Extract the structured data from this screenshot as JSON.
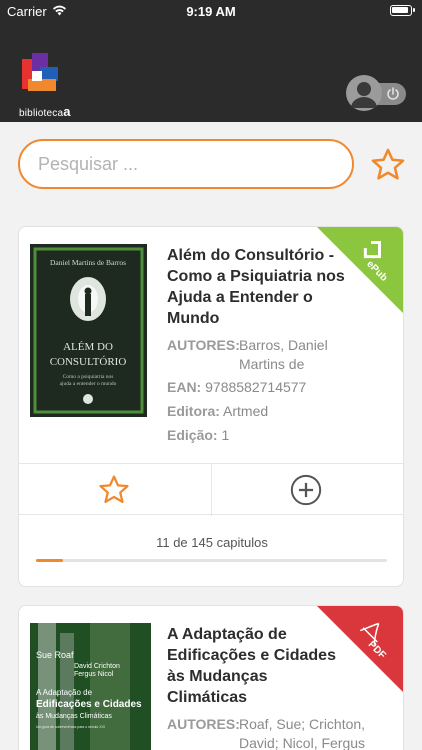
{
  "status_bar": {
    "carrier": "Carrier",
    "time": "9:19 AM"
  },
  "header": {
    "logo_text": "biblioteca",
    "logo_suffix": "a"
  },
  "search": {
    "placeholder": "Pesquisar ..."
  },
  "colors": {
    "accent": "#f0882d",
    "epub": "#8cc63f",
    "pdf": "#d9373b",
    "header_bg": "#2b2b2b"
  },
  "books": [
    {
      "title": "Além do Consultório - Como a Psiquiatria nos Ajuda a Entender o Mundo",
      "format": "ePub",
      "cover": {
        "author": "Daniel Martins de Barros",
        "title_l1": "ALÉM DO",
        "title_l2": "CONSULTÓRIO",
        "sub_l1": "Como a psiquiatria nos",
        "sub_l2": "ajuda a entender o mundo"
      },
      "meta": [
        {
          "label": "AUTORES:",
          "value": "Barros, Daniel Martins de"
        },
        {
          "label": "EAN:",
          "value": "9788582714577"
        },
        {
          "label": "Editora:",
          "value": "Artmed"
        },
        {
          "label": "Edição:",
          "value": "1"
        }
      ],
      "progress_text": "11 de 145 capitulos",
      "progress_fraction": 0.0759
    },
    {
      "title": "A Adaptação de Edificações e Cidades às Mudanças Climáticas",
      "format": "PDF",
      "cover": {
        "author_l1": "Sue Roaf",
        "author_l2": "David Crichton",
        "author_l3": "Fergus Nicol",
        "title_l1": "A Adaptação de",
        "title_l2": "Edificações e Cidades",
        "title_l3": "às Mudanças Climáticas",
        "sub": "Um guia de sobrevivência para o século XXI"
      },
      "meta": [
        {
          "label": "AUTORES:",
          "value": "Roaf, Sue; Crichton, David; Nicol, Fergus"
        }
      ]
    }
  ]
}
